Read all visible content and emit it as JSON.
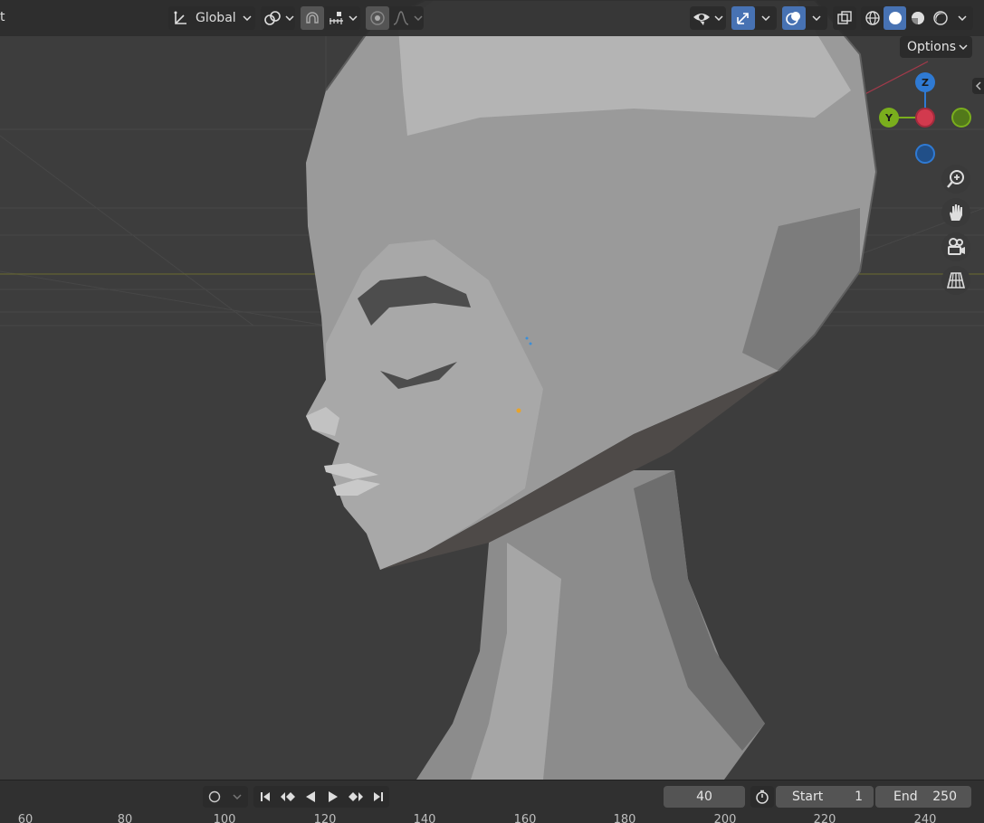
{
  "header": {
    "left_fragment": "t",
    "transform_orientation": "Global",
    "options_label": "Options",
    "icons": {
      "orientation": "transform-orientation-icon",
      "pivot": "pivot-point-icon",
      "snap": "snap-magnet-icon",
      "snap_target": "snap-increment-icon",
      "proportional": "proportional-editing-icon",
      "falloff": "falloff-curve-icon",
      "visibility": "object-visibility-icon",
      "gizmo": "gizmo-toggle-icon",
      "overlays": "overlays-icon",
      "xray": "xray-toggle-icon",
      "shading_wire": "wireframe-shading-icon",
      "shading_solid": "solid-shading-icon",
      "shading_material": "material-preview-icon",
      "shading_render": "rendered-shading-icon"
    }
  },
  "gizmo": {
    "z_label": "Z",
    "y_label": "Y",
    "colors": {
      "x": "#d23a4e",
      "y": "#7aae1d",
      "z": "#2f7ad3"
    }
  },
  "nav_buttons": [
    "zoom-icon",
    "pan-hand-icon",
    "camera-view-icon",
    "perspective-grid-icon"
  ],
  "timeline": {
    "current_frame": "40",
    "start_label": "Start",
    "start_value": "1",
    "end_label": "End",
    "end_value": "250",
    "ruler": [
      "60",
      "80",
      "100",
      "120",
      "140",
      "160",
      "180",
      "200",
      "220",
      "240"
    ]
  },
  "colors": {
    "accent": "#4772b3",
    "viewport_bg": "#3d3d3d",
    "origin_dot": "#e8a42a"
  }
}
